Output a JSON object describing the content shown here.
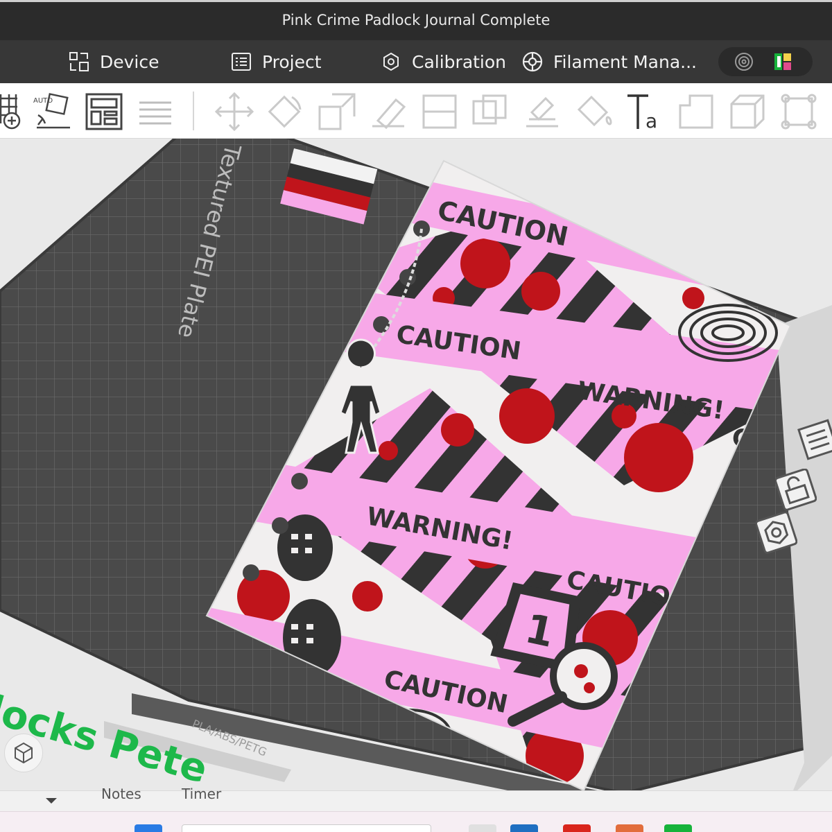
{
  "window": {
    "title": "Pink Crime Padlock Journal Complete"
  },
  "menubar": {
    "items": [
      {
        "label": "Device",
        "icon": "device-icon"
      },
      {
        "label": "Project",
        "icon": "project-icon"
      },
      {
        "label": "Calibration",
        "icon": "calibration-icon"
      },
      {
        "label": "Filament Mana...",
        "icon": "filament-icon"
      }
    ]
  },
  "toolbar": {
    "auto_label": "AUTO",
    "icons": [
      "add-plate-icon",
      "auto-orient-icon",
      "arrange-icon",
      "layers-icon",
      "move-icon",
      "rotate-icon",
      "scale-icon",
      "lay-on-face-icon",
      "cut-icon",
      "boolean-icon",
      "support-paint-icon",
      "seam-paint-icon",
      "color-paint-icon",
      "text-icon",
      "emboss-icon",
      "measure-icon",
      "assembly-icon"
    ]
  },
  "plate": {
    "name": "Textured PEI Plate",
    "materials": "PLA/ABS/PETG"
  },
  "model": {
    "tape_labels": [
      "CAUTION",
      "CAUTION",
      "WARNING!",
      "WARNING!",
      "CAUTION",
      "CAUTION",
      "C"
    ],
    "evidence_marker": "1"
  },
  "overlay_text": "locks Pete",
  "bottom": {
    "notes": "Notes",
    "timer": "Timer"
  },
  "colors": {
    "titlebar": "#2b2b2b",
    "menubar": "#373737",
    "plate": "#4c4c4c",
    "pink": "#f7a8e8",
    "blood": "#c0141b",
    "tape_dark": "#333333",
    "accent_green": "#14b83c"
  }
}
